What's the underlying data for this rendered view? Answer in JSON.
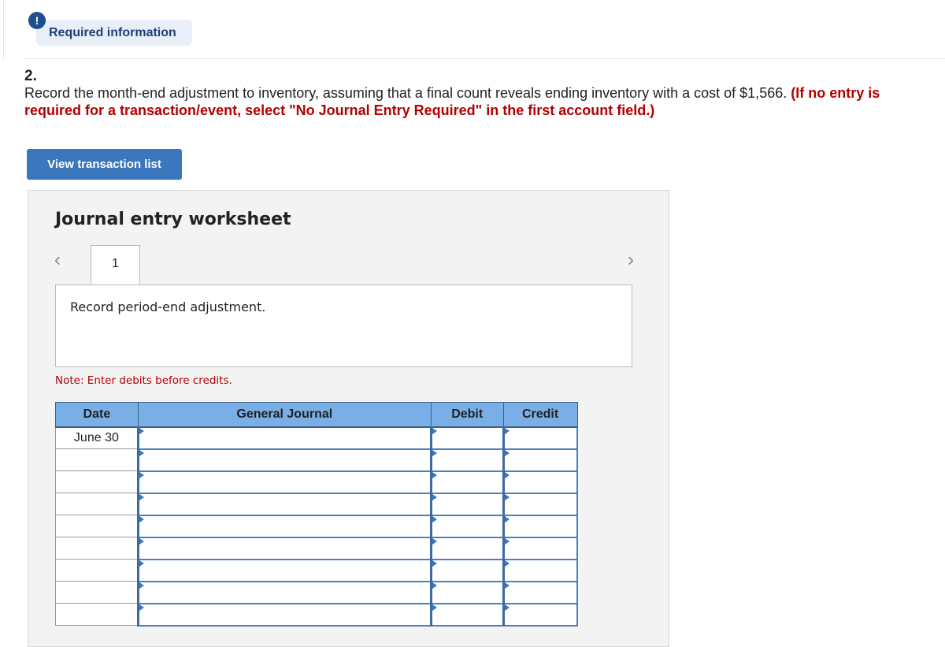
{
  "header": {
    "alert_icon": "exclamation-icon",
    "required_info": "Required information"
  },
  "question": {
    "number": "2.",
    "text": "Record the month-end adjustment to inventory, assuming that a final count reveals ending inventory with a cost of $1,566. ",
    "instruction": "(If no entry is required for a transaction/event, select \"No Journal Entry Required\" in the first account field.)"
  },
  "view_button": "View transaction list",
  "worksheet": {
    "title": "Journal entry worksheet",
    "tab": "1",
    "prev_icon": "chevron-left-icon",
    "next_icon": "chevron-right-icon",
    "description": "Record period-end adjustment.",
    "note": "Note: Enter debits before credits.",
    "columns": [
      "Date",
      "General Journal",
      "Debit",
      "Credit"
    ],
    "rows": [
      {
        "date": "June 30"
      },
      {
        "date": ""
      },
      {
        "date": ""
      },
      {
        "date": ""
      },
      {
        "date": ""
      },
      {
        "date": ""
      },
      {
        "date": ""
      },
      {
        "date": ""
      },
      {
        "date": ""
      }
    ]
  },
  "colors": {
    "accent": "#3a77bd",
    "header": "#7aaee6",
    "warning": "#b30000"
  }
}
